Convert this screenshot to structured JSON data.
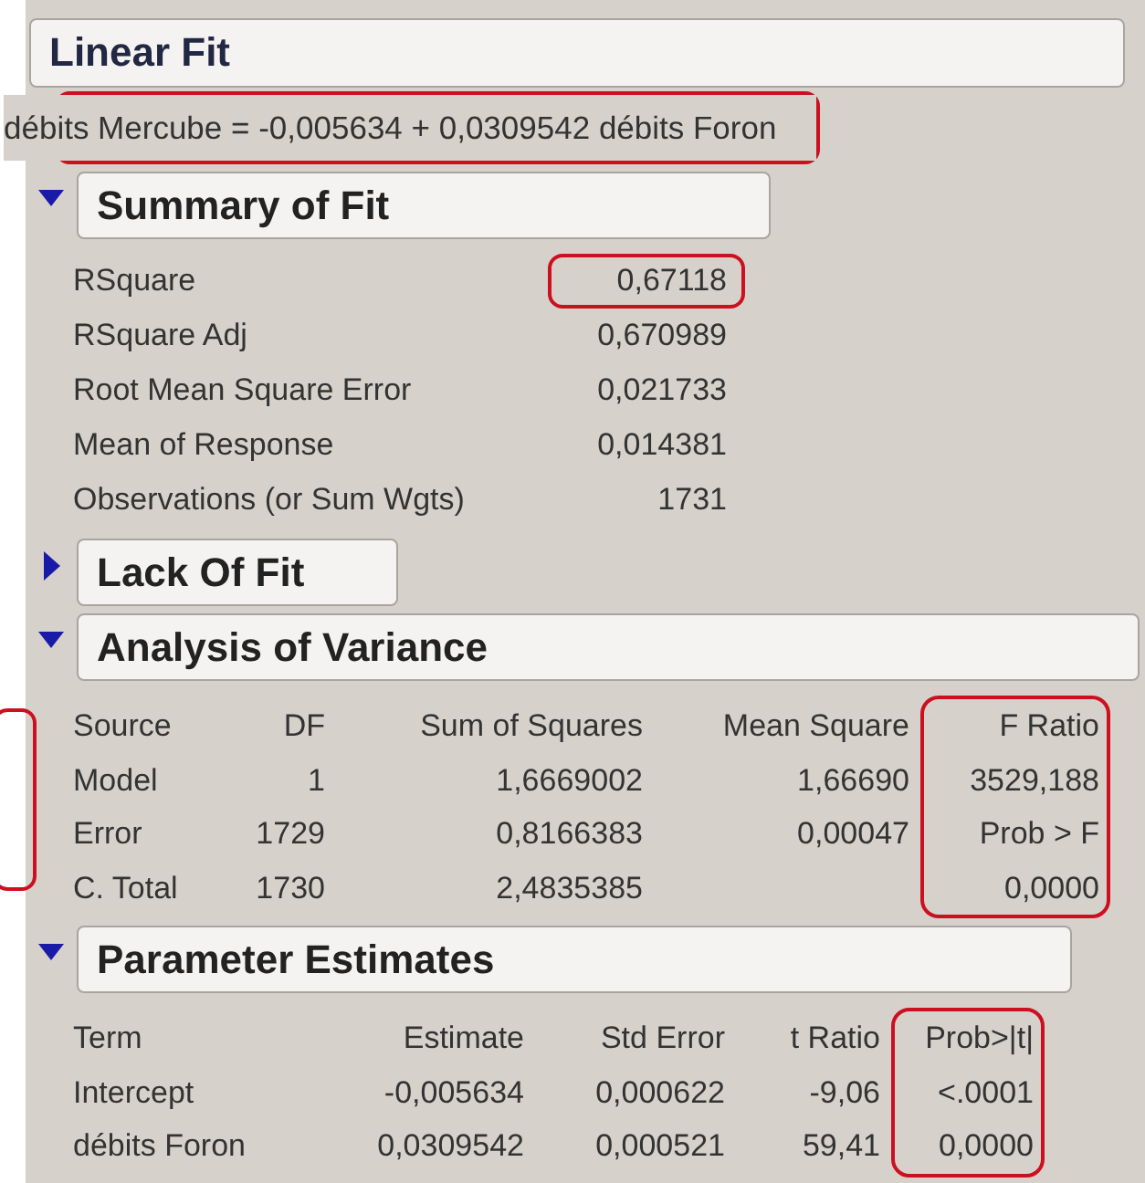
{
  "title": "Linear Fit",
  "equation": {
    "text": "débits Mercube = -0,005634 + 0,0309542 débits Foron",
    "highlighted": true
  },
  "sections": [
    {
      "title": "Summary of Fit",
      "expanded": true,
      "kind": "summary",
      "rows": [
        {
          "label": "RSquare",
          "value": "0,67118",
          "highlighted": true
        },
        {
          "label": "RSquare Adj",
          "value": "0,670989",
          "highlighted": false
        },
        {
          "label": "Root Mean Square Error",
          "value": "0,021733",
          "highlighted": false
        },
        {
          "label": "Mean of Response",
          "value": "0,014381",
          "highlighted": false
        },
        {
          "label": "Observations (or Sum Wgts)",
          "value": "1731",
          "highlighted": false
        }
      ]
    },
    {
      "title": "Lack Of Fit",
      "expanded": false
    },
    {
      "title": "Analysis of Variance",
      "expanded": true,
      "kind": "table",
      "columns": [
        {
          "header": "Source",
          "cells": [
            "Model",
            "Error",
            "C. Total"
          ],
          "highlighted": false
        },
        {
          "header": "DF",
          "cells": [
            "1",
            "1729",
            "1730"
          ],
          "highlighted": false
        },
        {
          "header": "Sum of Squares",
          "cells": [
            "1,6669002",
            "0,8166383",
            "2,4835385"
          ],
          "highlighted": false
        },
        {
          "header": "Mean Square",
          "cells": [
            "1,66690",
            "0,00047",
            null
          ],
          "highlighted": false
        },
        {
          "header": "F Ratio",
          "cells": [
            "3529,188",
            "Prob > F",
            "0,0000"
          ],
          "highlighted": true
        }
      ]
    },
    {
      "title": "Parameter Estimates",
      "expanded": true,
      "kind": "table",
      "columns": [
        {
          "header": "Term",
          "cells": [
            "Intercept",
            "débits Foron"
          ],
          "highlighted": false
        },
        {
          "header": "Estimate",
          "cells": [
            "-0,005634",
            "0,0309542"
          ],
          "highlighted": false
        },
        {
          "header": "Std Error",
          "cells": [
            "0,000622",
            "0,000521"
          ],
          "highlighted": false
        },
        {
          "header": "t Ratio",
          "cells": [
            "-9,06",
            "59,41"
          ],
          "highlighted": false
        },
        {
          "header": "Prob>|t|",
          "cells": [
            "<.0001",
            "0,0000"
          ],
          "highlighted": true
        }
      ]
    }
  ]
}
